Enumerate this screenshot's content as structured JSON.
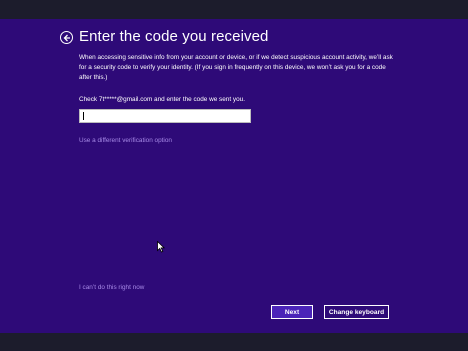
{
  "header": {
    "title": "Enter the code you received"
  },
  "description": "When accessing sensitive info from your account or device, or if we detect suspicious account activity, we’ll ask for a security code to verify your identity. (If you sign in frequently on this device, we won’t ask you for a code after this.)",
  "check_text": "Check 7t*****@gmail.com and enter the code we sent you.",
  "code_input": {
    "value": "",
    "placeholder": ""
  },
  "links": {
    "different_option": "Use a different verification option",
    "cant_do_now": "I can’t do this right now"
  },
  "buttons": {
    "next": "Next",
    "change_keyboard": "Change keyboard"
  },
  "icons": {
    "back": "back-arrow-icon",
    "pointer": "mouse-pointer-icon"
  },
  "colors": {
    "background": "#2e0a78",
    "link": "#a689e6",
    "primary_button": "#4b24b8"
  }
}
